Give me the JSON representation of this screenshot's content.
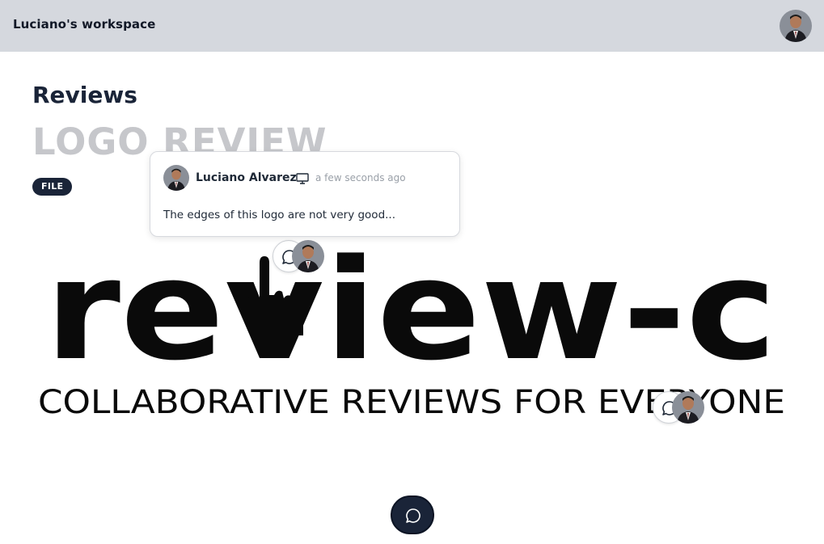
{
  "header": {
    "workspace_title": "Luciano's workspace",
    "avatar": "user-avatar"
  },
  "page": {
    "title": "Reviews",
    "review_title": "LOGO REVIEW",
    "badge": "FILE"
  },
  "image": {
    "logo_text": "review-c",
    "tagline": "COLLABORATIVE REVIEWS FOR EVERYONE"
  },
  "comment_popup": {
    "author": "Luciano Alvarez",
    "device_icon": "monitor-icon",
    "time": "a few seconds ago",
    "text": "The edges of this logo are not very good..."
  },
  "markers": [
    {
      "icon": "comment-icon",
      "avatar": "user-avatar"
    },
    {
      "icon": "comment-icon",
      "avatar": "user-avatar"
    }
  ],
  "fab": {
    "icon": "comment-icon"
  },
  "colors": {
    "topbar_bg": "#d5d8de",
    "primary_dark": "#1a2438",
    "muted_title": "#c6c7cb"
  }
}
